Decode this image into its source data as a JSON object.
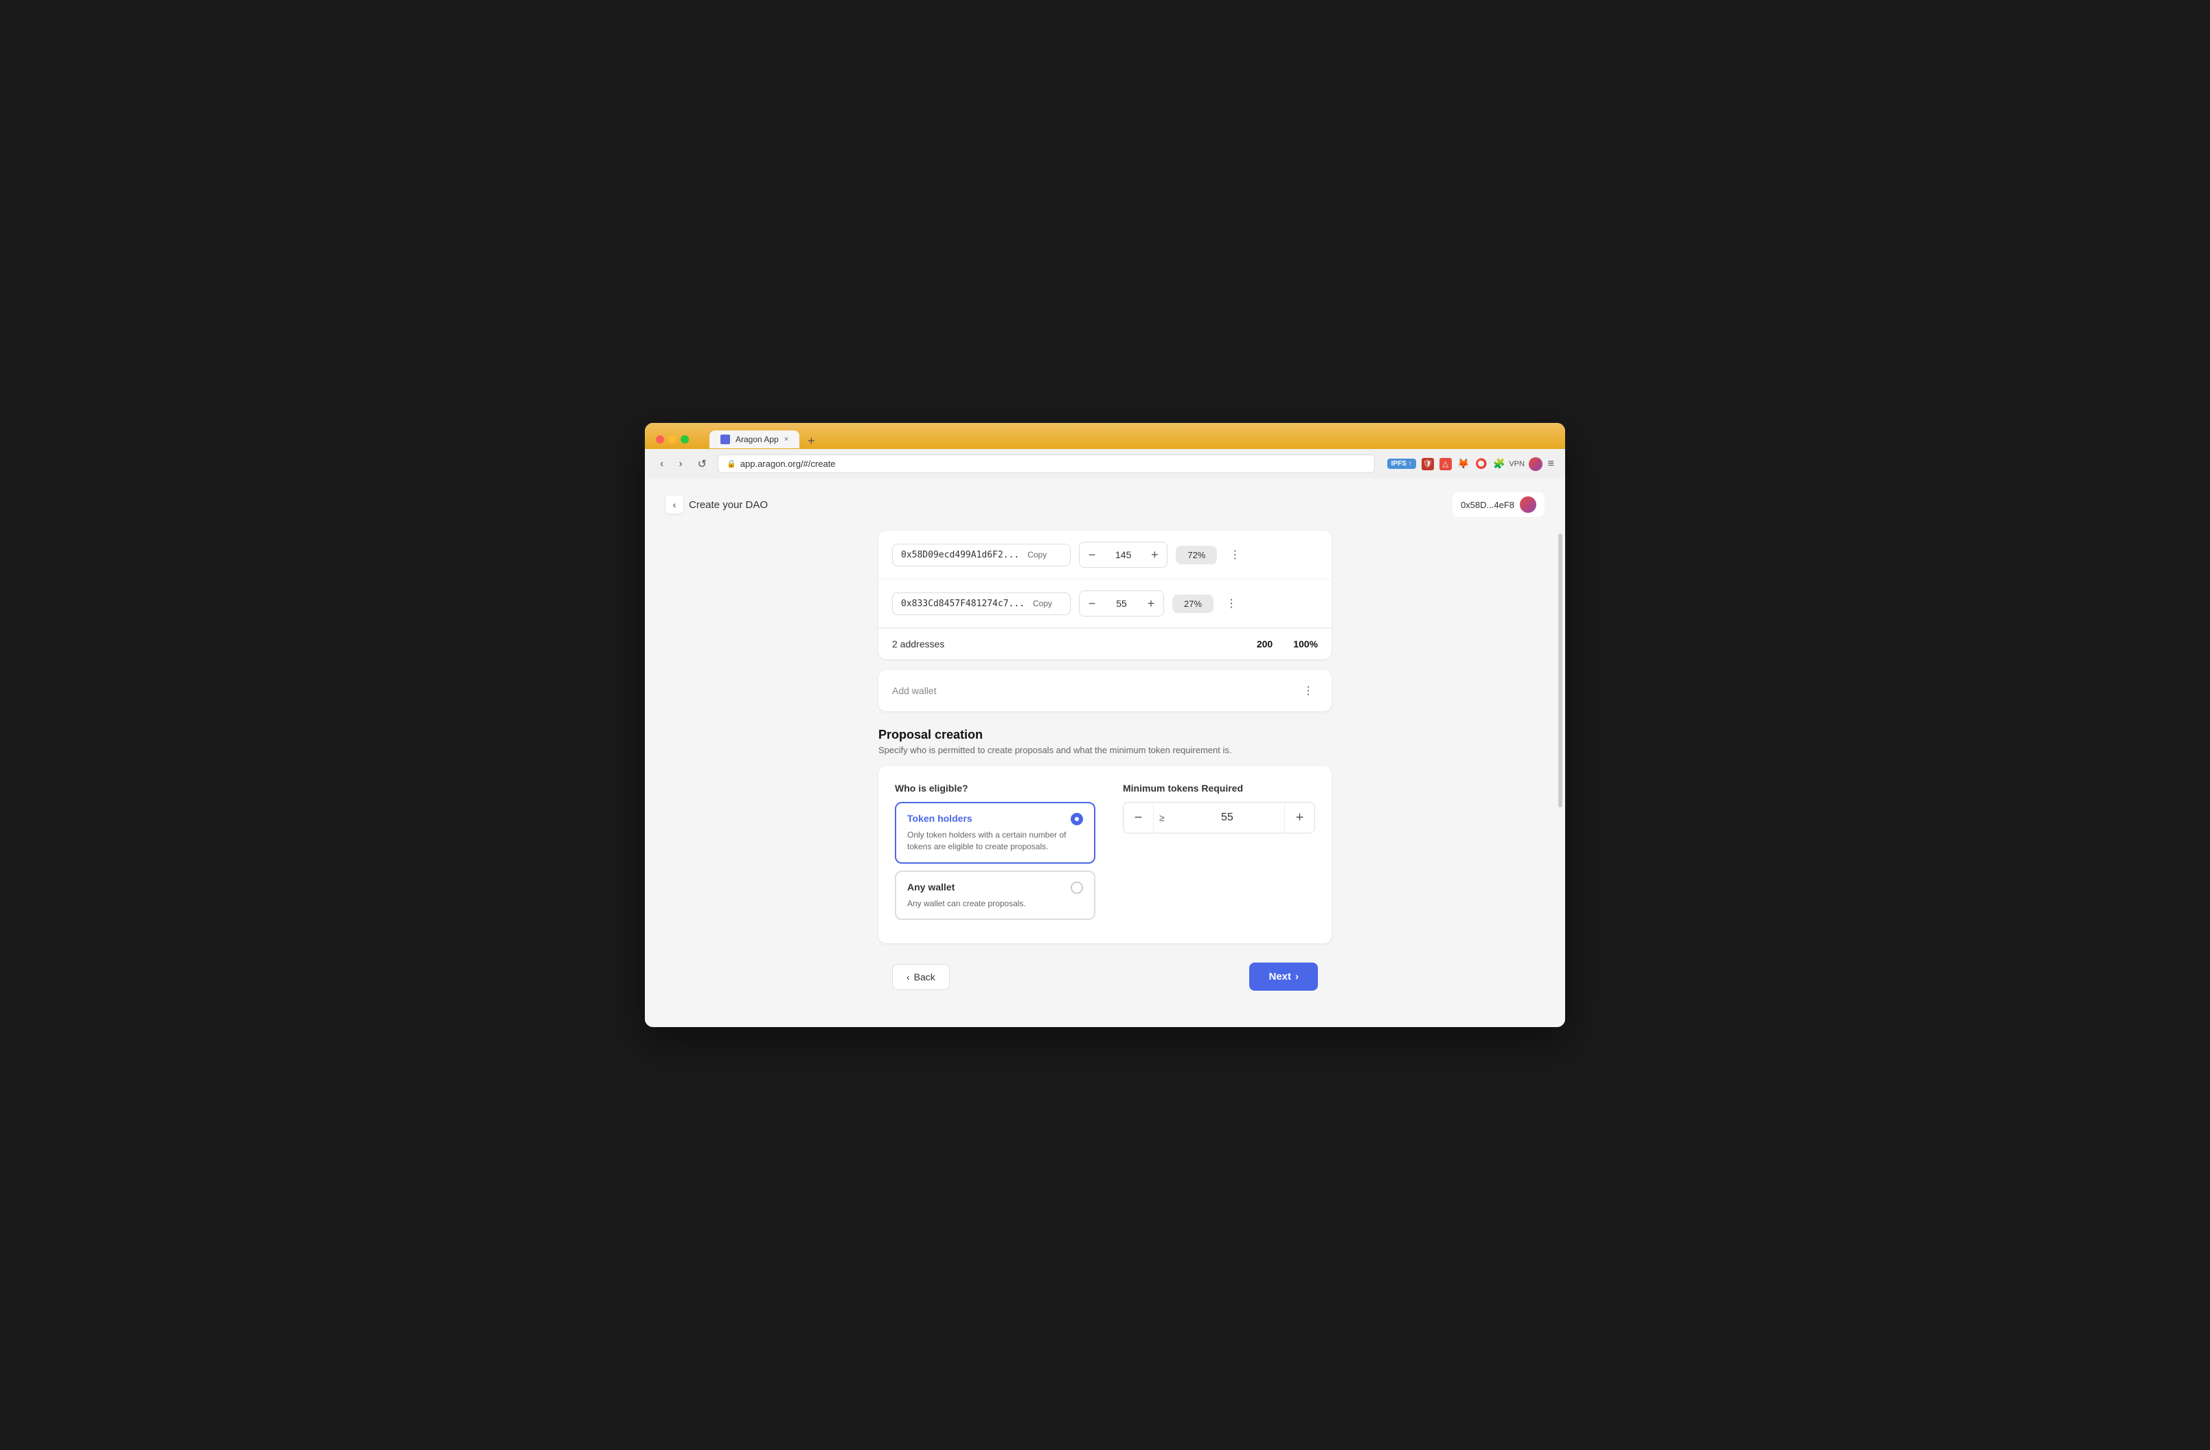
{
  "browser": {
    "tab_title": "Aragon App",
    "tab_close": "×",
    "new_tab": "+",
    "url": "app.aragon.org/#/create",
    "nav_back": "‹",
    "nav_forward": "›",
    "nav_refresh": "↺",
    "extensions": {
      "ipfs_label": "IPFS ↑",
      "chevron_down": "⌄",
      "menu": "≡"
    }
  },
  "header": {
    "back_chevron": "‹",
    "title": "Create your DAO",
    "wallet_address": "0x58D...4eF8"
  },
  "addresses": [
    {
      "address": "0x58D09ecd499A1d6F2...",
      "copy_label": "Copy",
      "amount": "145",
      "percent": "72%"
    },
    {
      "address": "0x833Cd8457F481274c7...",
      "copy_label": "Copy",
      "amount": "55",
      "percent": "27%"
    }
  ],
  "summary": {
    "label": "2 addresses",
    "total_amount": "200",
    "total_percent": "100%"
  },
  "add_wallet": {
    "label": "Add wallet"
  },
  "proposal_creation": {
    "title": "Proposal creation",
    "description": "Specify who is permitted to create proposals and what the minimum token requirement is.",
    "eligibility_column_title": "Who is eligible?",
    "min_tokens_column_title": "Minimum tokens Required",
    "options": [
      {
        "id": "token-holders",
        "title": "Token holders",
        "description": "Only token holders with a certain number of tokens are eligible to create proposals.",
        "selected": true
      },
      {
        "id": "any-wallet",
        "title": "Any wallet",
        "description": "Any wallet can create proposals.",
        "selected": false
      }
    ],
    "min_tokens_value": "55",
    "gte_symbol": "≥"
  },
  "navigation": {
    "back_label": "Back",
    "next_label": "Next",
    "back_chevron": "‹",
    "next_chevron": "›"
  }
}
